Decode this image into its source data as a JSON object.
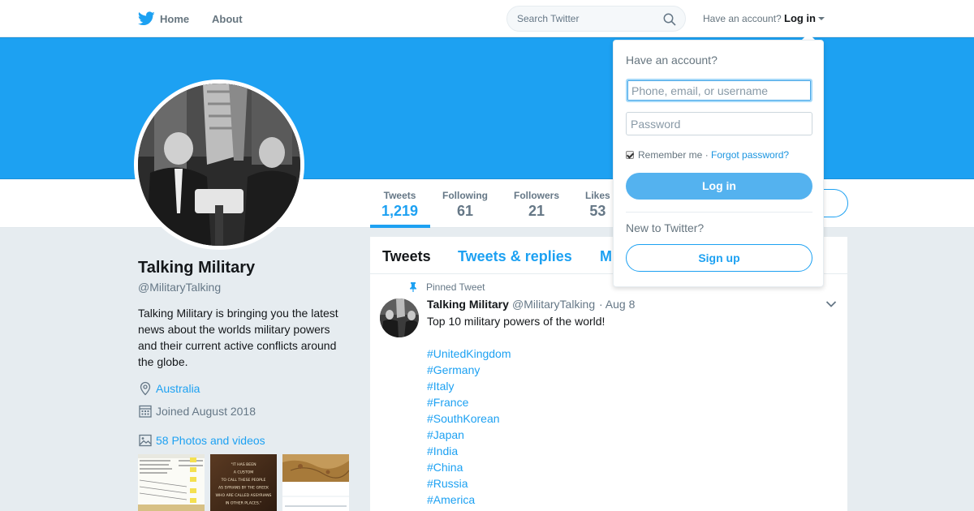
{
  "nav": {
    "home": "Home",
    "about": "About",
    "search_placeholder": "Search Twitter",
    "have_account": "Have an account?",
    "login": "Log in"
  },
  "colors": {
    "brand": "#1da1f2",
    "banner": "#1da1f2"
  },
  "profile": {
    "name": "Talking Military",
    "handle": "@MilitaryTalking",
    "bio": "Talking Military is bringing you the latest news about the worlds military powers and their current active conflicts around the globe.",
    "location": "Australia",
    "joined": "Joined August 2018",
    "photos": "58 Photos and videos"
  },
  "stats": [
    {
      "label": "Tweets",
      "value": "1,219"
    },
    {
      "label": "Following",
      "value": "61"
    },
    {
      "label": "Followers",
      "value": "21"
    },
    {
      "label": "Likes",
      "value": "53"
    }
  ],
  "timeline": {
    "tabs": [
      "Tweets",
      "Tweets & replies",
      "M"
    ],
    "pinned_label": "Pinned Tweet",
    "tweet": {
      "name": "Talking Military",
      "handle": "@MilitaryTalking",
      "date": "· Aug 8",
      "text": "Top 10 military powers of the world!",
      "hashtags": [
        "#UnitedKingdom",
        "#Germany",
        "#Italy",
        "#France",
        "#SouthKorean",
        "#Japan",
        "#India",
        "#China",
        "#Russia",
        "#America"
      ]
    }
  },
  "login_dropdown": {
    "title": "Have an account?",
    "username_placeholder": "Phone, email, or username",
    "password_placeholder": "Password",
    "remember": "Remember me",
    "separator": " · ",
    "forgot": "Forgot password?",
    "login_button": "Log in",
    "new_to": "New to Twitter?",
    "signup_button": "Sign up"
  },
  "thumbs": {
    "thumb2_lines": [
      "\"IT HAS BEEN",
      "A CUSTOM",
      "TO CALL THESE PEOPLE",
      "AS SYRIANS BY THE GREEK",
      "WHO ARE CALLED ASSYRIANS",
      "IN OTHER PLACES.\""
    ]
  }
}
